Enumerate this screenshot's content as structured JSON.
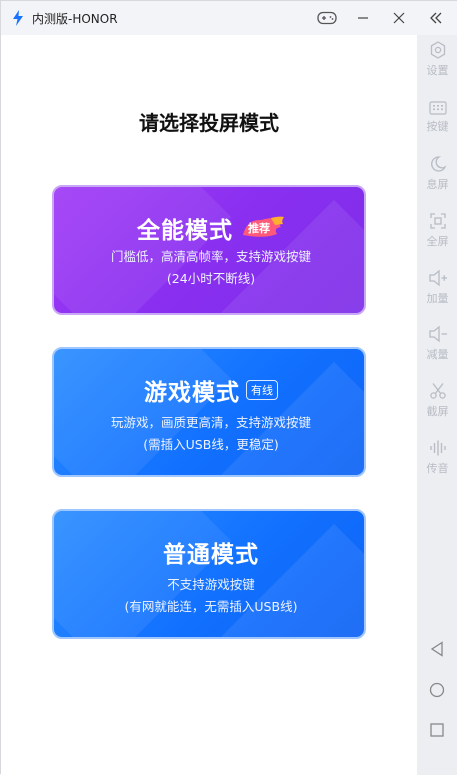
{
  "window": {
    "title": "内测版-HONOR"
  },
  "main": {
    "heading": "请选择投屏模式",
    "cards": [
      {
        "title": "全能模式",
        "badge": "推荐",
        "desc_line1": "门槛低，高清高帧率，支持游戏按键",
        "desc_line2": "(24小时不断线)"
      },
      {
        "title": "游戏模式",
        "badge": "有线",
        "desc_line1": "玩游戏，画质更高清，支持游戏按键",
        "desc_line2": "(需插入USB线，更稳定)"
      },
      {
        "title": "普通模式",
        "desc_line1": "不支持游戏按键",
        "desc_line2": "(有网就能连，无需插入USB线)"
      }
    ]
  },
  "sidebar": {
    "items": [
      {
        "label": "设置",
        "icon": "gear-icon"
      },
      {
        "label": "按键",
        "icon": "keyboard-icon"
      },
      {
        "label": "息屏",
        "icon": "moon-icon"
      },
      {
        "label": "全屏",
        "icon": "fullscreen-icon"
      },
      {
        "label": "加量",
        "icon": "volume-up-icon"
      },
      {
        "label": "减量",
        "icon": "volume-down-icon"
      },
      {
        "label": "截屏",
        "icon": "scissors-icon"
      },
      {
        "label": "传音",
        "icon": "audio-wave-icon"
      }
    ],
    "nav": [
      "back-triangle-icon",
      "home-circle-icon",
      "recent-square-icon"
    ]
  },
  "colors": {
    "card_purple": "#8a2ff0",
    "card_blue": "#1271ff",
    "sidebar_icon": "#b8bcc4"
  }
}
